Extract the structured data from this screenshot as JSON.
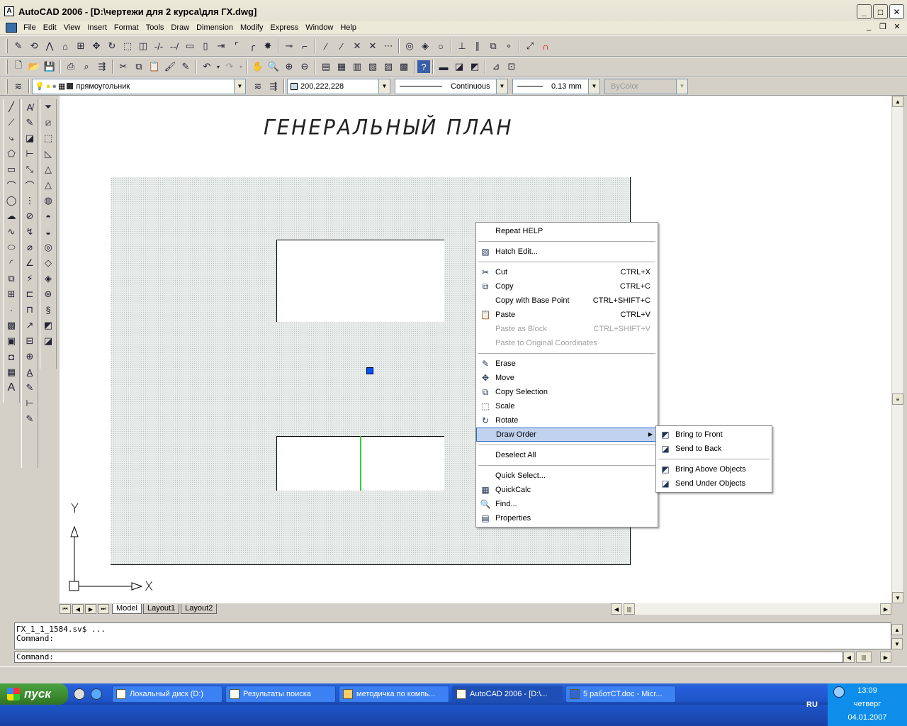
{
  "window": {
    "title": "AutoCAD 2006 - [D:\\чертежи для 2 курса\\для ГХ.dwg]"
  },
  "menubar": [
    "File",
    "Edit",
    "View",
    "Insert",
    "Format",
    "Tools",
    "Draw",
    "Dimension",
    "Modify",
    "Express",
    "Window",
    "Help"
  ],
  "properties": {
    "layer": "прямоугольник",
    "color": "200,222,228",
    "linetype": "Continuous",
    "lineweight": "0.13 mm",
    "plotstyle": "ByColor",
    "color_swatch": "#c8dee4"
  },
  "drawing": {
    "title": "ГЕНЕРАЛЬНЫЙ ПЛАН",
    "ucs_x": "X",
    "ucs_y": "Y"
  },
  "layout_tabs": [
    "Model",
    "Layout1",
    "Layout2"
  ],
  "context_menu": [
    {
      "label": "Repeat HELP",
      "shortcut": "",
      "icon": ""
    },
    {
      "sep": true
    },
    {
      "label": "Hatch Edit...",
      "shortcut": "",
      "icon": "hatch-icon"
    },
    {
      "sep": true
    },
    {
      "label": "Cut",
      "shortcut": "CTRL+X",
      "icon": "scissors-icon"
    },
    {
      "label": "Copy",
      "shortcut": "CTRL+C",
      "icon": "copy-icon"
    },
    {
      "label": "Copy with Base Point",
      "shortcut": "CTRL+SHIFT+C",
      "icon": ""
    },
    {
      "label": "Paste",
      "shortcut": "CTRL+V",
      "icon": "paste-icon"
    },
    {
      "label": "Paste as Block",
      "shortcut": "CTRL+SHIFT+V",
      "icon": "",
      "disabled": true
    },
    {
      "label": "Paste to Original Coordinates",
      "shortcut": "",
      "icon": "",
      "disabled": true
    },
    {
      "sep": true
    },
    {
      "label": "Erase",
      "shortcut": "",
      "icon": "eraser-icon"
    },
    {
      "label": "Move",
      "shortcut": "",
      "icon": "move-icon"
    },
    {
      "label": "Copy Selection",
      "shortcut": "",
      "icon": "copy-selection-icon"
    },
    {
      "label": "Scale",
      "shortcut": "",
      "icon": "scale-icon"
    },
    {
      "label": "Rotate",
      "shortcut": "",
      "icon": "rotate-icon"
    },
    {
      "label": "Draw Order",
      "shortcut": "",
      "icon": "",
      "submenu": true,
      "highlight": true
    },
    {
      "sep": true
    },
    {
      "label": "Deselect All",
      "shortcut": "",
      "icon": ""
    },
    {
      "sep": true
    },
    {
      "label": "Quick Select...",
      "shortcut": "",
      "icon": ""
    },
    {
      "label": "QuickCalc",
      "shortcut": "",
      "icon": "calculator-icon"
    },
    {
      "label": "Find...",
      "shortcut": "",
      "icon": "find-icon"
    },
    {
      "label": "Properties",
      "shortcut": "",
      "icon": "properties-icon"
    }
  ],
  "submenu": [
    {
      "label": "Bring to Front",
      "icon": "bring-front-icon"
    },
    {
      "label": "Send to Back",
      "icon": "send-back-icon"
    },
    {
      "sep": true
    },
    {
      "label": "Bring Above Objects",
      "icon": "bring-above-icon"
    },
    {
      "label": "Send Under Objects",
      "icon": "send-under-icon"
    }
  ],
  "command": {
    "history_1": "ГХ_1_1_1584.sv$ ...",
    "history_2": "Command:",
    "prompt": "Command:"
  },
  "taskbar": {
    "start": "пуск",
    "buttons": [
      "Локальный диск (D:)",
      "Результаты поиска",
      "методичка по компь...",
      "AutoCAD 2006 - [D:\\...",
      "5 работСТ.doc - Micr..."
    ],
    "active_index": 3,
    "lang": "RU",
    "time": "13:09",
    "day": "четверг",
    "date": "04.01.2007"
  }
}
